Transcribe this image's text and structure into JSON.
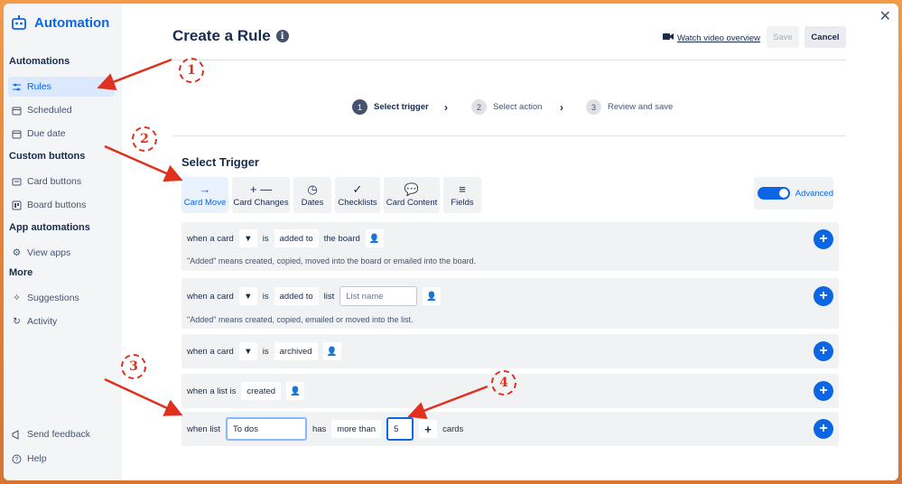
{
  "sidebar": {
    "brand": "Automation",
    "sections": [
      {
        "title": "Automations",
        "items": [
          {
            "label": "Rules",
            "icon": "sliders-icon",
            "active": true
          },
          {
            "label": "Scheduled",
            "icon": "calendar-icon"
          },
          {
            "label": "Due date",
            "icon": "calendar-icon"
          }
        ]
      },
      {
        "title": "Custom buttons",
        "items": [
          {
            "label": "Card buttons",
            "icon": "card-icon"
          },
          {
            "label": "Board buttons",
            "icon": "board-icon"
          }
        ]
      },
      {
        "title": "App automations",
        "items": [
          {
            "label": "View apps",
            "icon": "gear-icon"
          }
        ]
      },
      {
        "title": "More",
        "items": [
          {
            "label": "Suggestions",
            "icon": "sparkle-icon"
          },
          {
            "label": "Activity",
            "icon": "refresh-icon"
          }
        ]
      }
    ],
    "footer": [
      {
        "label": "Send feedback",
        "icon": "megaphone-icon"
      },
      {
        "label": "Help",
        "icon": "help-icon"
      }
    ]
  },
  "header": {
    "title": "Create a Rule",
    "video_link": "Watch video overview",
    "save_label": "Save",
    "cancel_label": "Cancel"
  },
  "steps": [
    {
      "num": "1",
      "label": "Select trigger",
      "active": true
    },
    {
      "num": "2",
      "label": "Select action"
    },
    {
      "num": "3",
      "label": "Review and save"
    }
  ],
  "trigger": {
    "title": "Select Trigger",
    "tabs": [
      {
        "label": "Card Move",
        "icon": "→",
        "active": true
      },
      {
        "label": "Card Changes",
        "icon": "+ —"
      },
      {
        "label": "Dates",
        "icon": "◷"
      },
      {
        "label": "Checklists",
        "icon": "✓"
      },
      {
        "label": "Card Content",
        "icon": "💬"
      },
      {
        "label": "Fields",
        "icon": "≡"
      }
    ],
    "advanced_label": "Advanced"
  },
  "rules": [
    {
      "parts": [
        "when a card",
        "is",
        "added to",
        "the board"
      ],
      "note": "\"Added\" means created, copied, moved into the board or emailed into the board."
    },
    {
      "parts": [
        "when a card",
        "is",
        "added to",
        "list"
      ],
      "placeholder": "List name",
      "note": "\"Added\" means created, copied, emailed or moved into the list."
    },
    {
      "parts": [
        "when a card",
        "is",
        "archived"
      ]
    },
    {
      "parts": [
        "when a list is",
        "created"
      ]
    },
    {
      "parts": [
        "when list",
        "has",
        "more than",
        "cards"
      ],
      "list_value": "To dos",
      "count_value": "5"
    }
  ],
  "annotations": [
    "1",
    "2",
    "3",
    "4"
  ],
  "colors": {
    "accent": "#0c66e4",
    "annotation": "#e0301e"
  }
}
